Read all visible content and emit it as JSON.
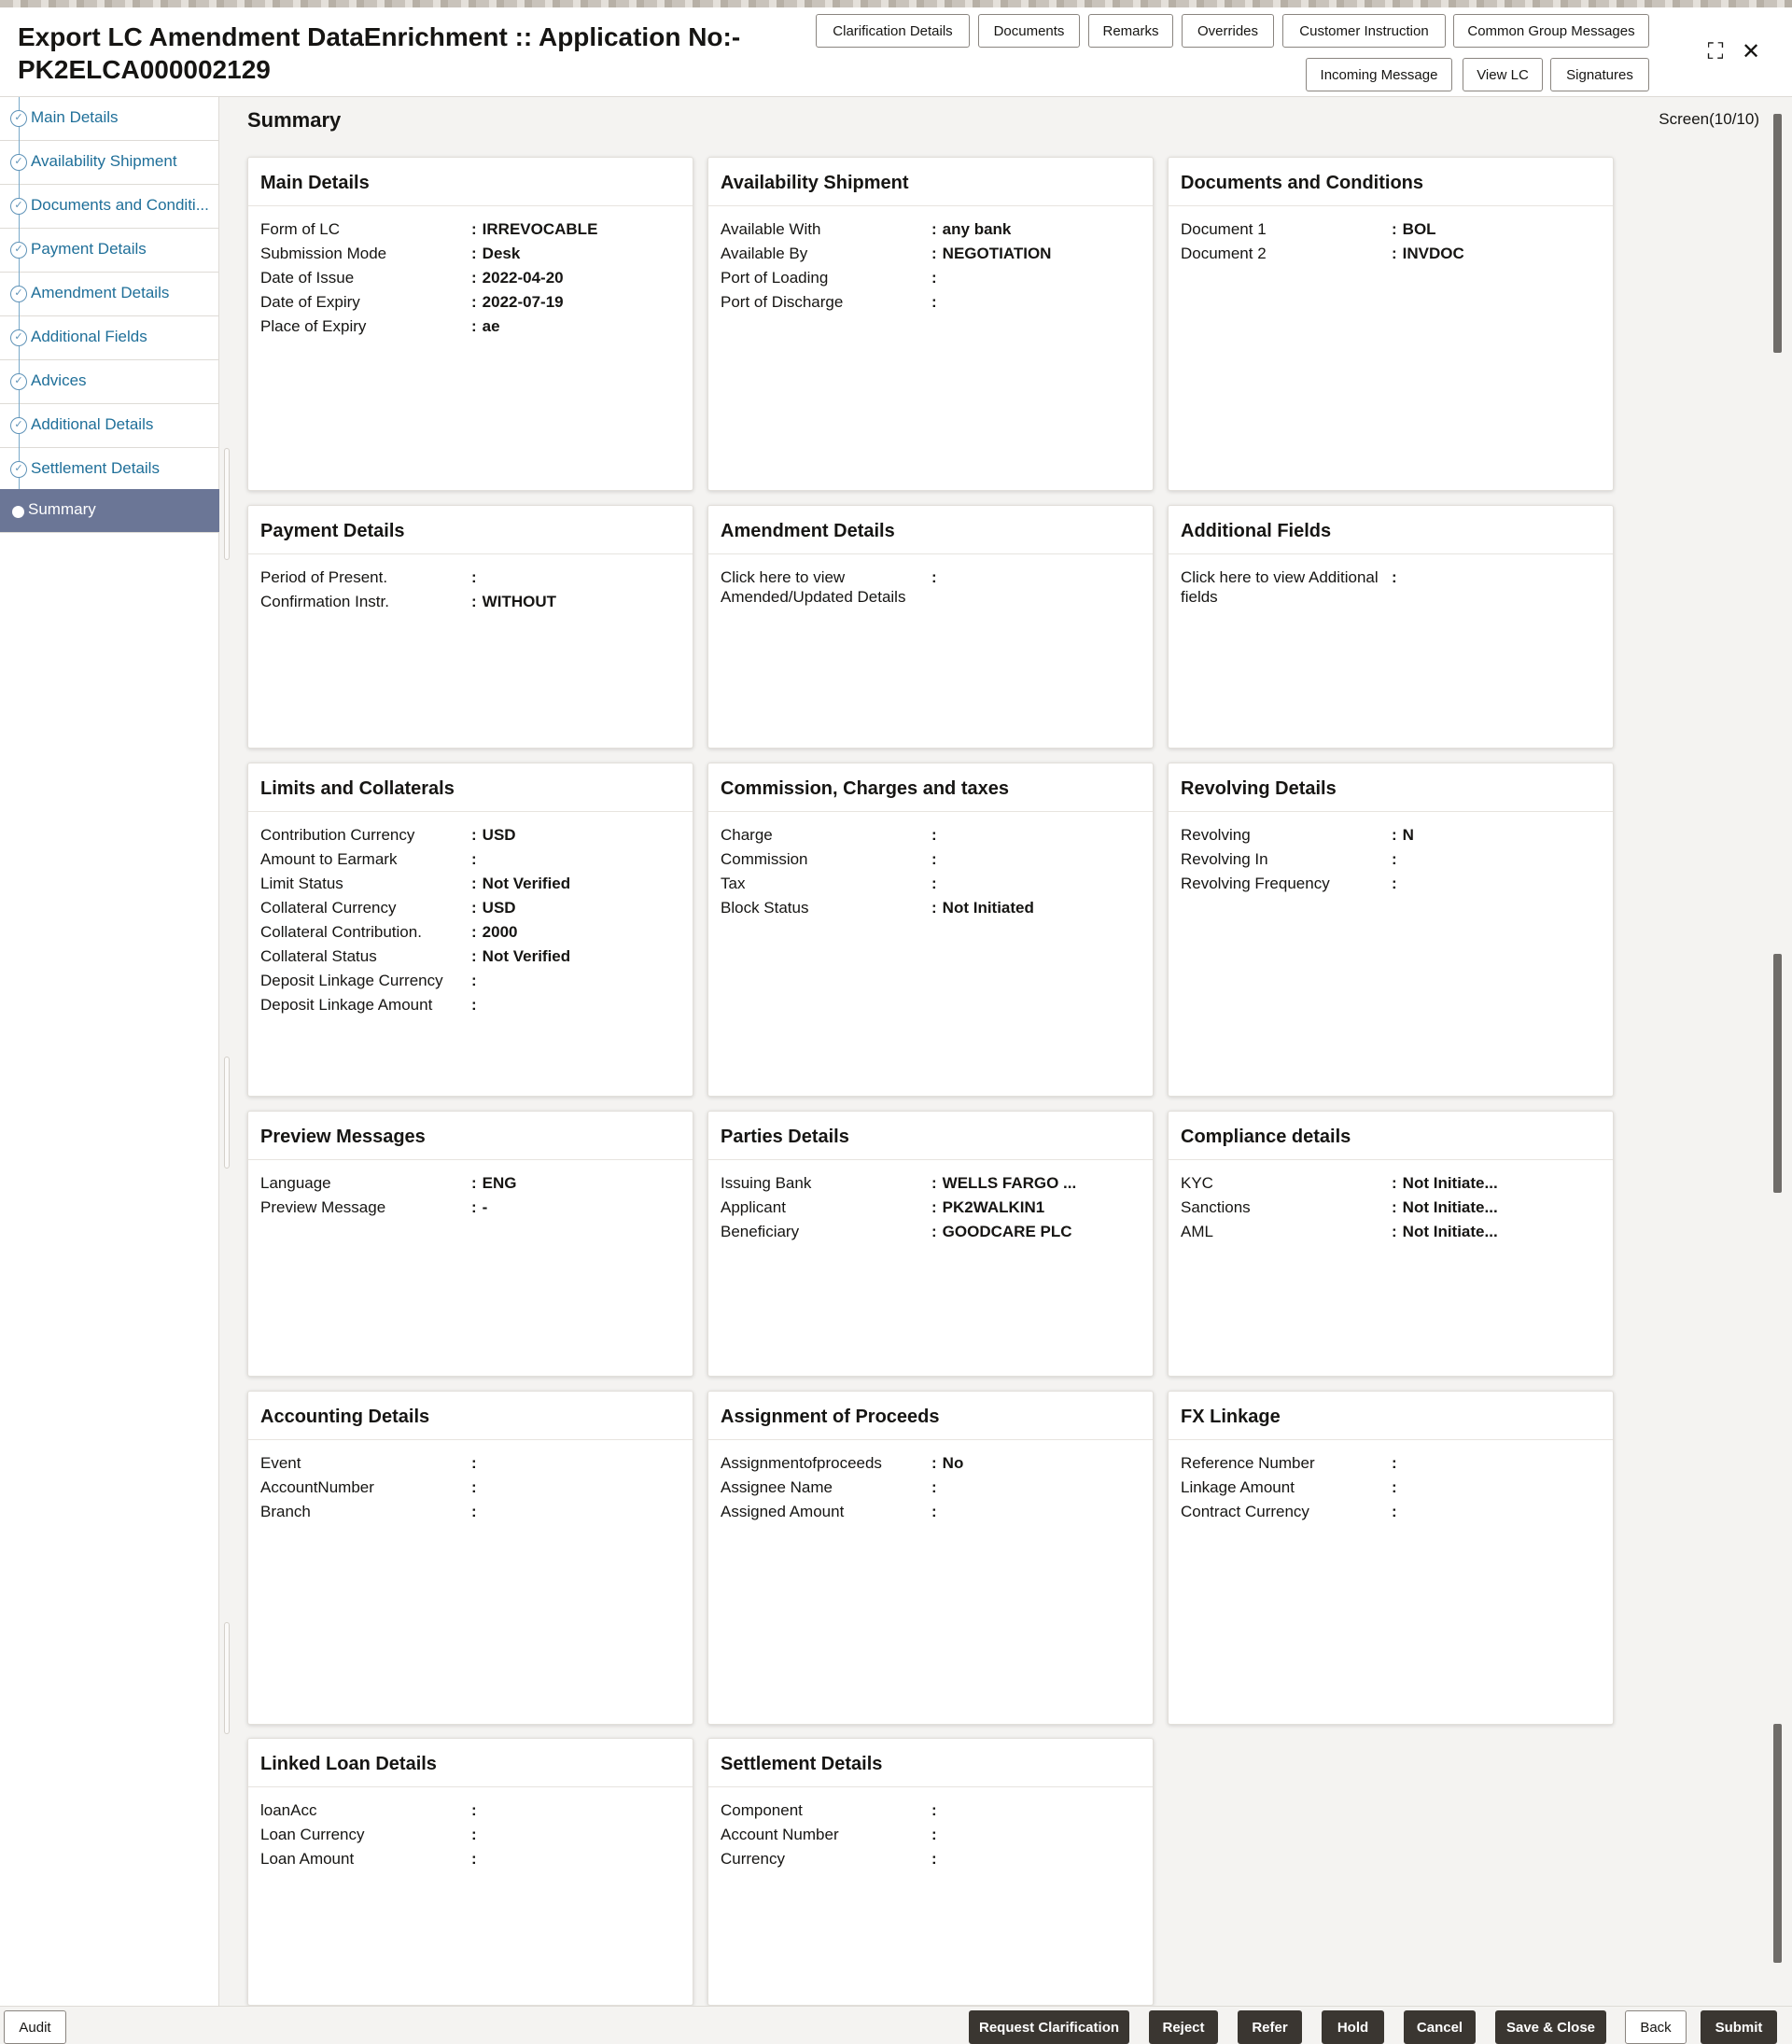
{
  "header": {
    "title": "Export LC Amendment DataEnrichment :: Application No:- PK2ELCA000002129",
    "buttons_row1": [
      "Clarification Details",
      "Documents",
      "Remarks",
      "Overrides",
      "Customer Instruction",
      "Common Group Messages"
    ],
    "buttons_row2": [
      "Incoming Message",
      "View LC",
      "Signatures"
    ],
    "minimize_glyph": "⛶",
    "close_glyph": "✕"
  },
  "sidebar": {
    "items": [
      {
        "label": "Main Details",
        "state": "done"
      },
      {
        "label": "Availability Shipment",
        "state": "done"
      },
      {
        "label": "Documents and Conditi...",
        "state": "done"
      },
      {
        "label": "Payment Details",
        "state": "done"
      },
      {
        "label": "Amendment Details",
        "state": "done"
      },
      {
        "label": "Additional Fields",
        "state": "done"
      },
      {
        "label": "Advices",
        "state": "done"
      },
      {
        "label": "Additional Details",
        "state": "done"
      },
      {
        "label": "Settlement Details",
        "state": "done"
      },
      {
        "label": "Summary",
        "state": "active"
      }
    ]
  },
  "main": {
    "title": "Summary",
    "screen_counter": "Screen(10/10)"
  },
  "cards": [
    {
      "title": "Main Details",
      "rows": [
        {
          "k": "Form of LC",
          "v": "IRREVOCABLE"
        },
        {
          "k": "Submission Mode",
          "v": "Desk"
        },
        {
          "k": "Date of Issue",
          "v": "2022-04-20"
        },
        {
          "k": "Date of Expiry",
          "v": "2022-07-19"
        },
        {
          "k": "Place of Expiry",
          "v": "ae"
        }
      ]
    },
    {
      "title": "Availability Shipment",
      "rows": [
        {
          "k": "Available With",
          "v": "any bank"
        },
        {
          "k": "Available By",
          "v": "NEGOTIATION"
        },
        {
          "k": "Port of Loading",
          "v": ""
        },
        {
          "k": "Port of Discharge",
          "v": ""
        }
      ]
    },
    {
      "title": "Documents and Conditions",
      "rows": [
        {
          "k": "Document 1",
          "v": "BOL"
        },
        {
          "k": "Document 2",
          "v": "INVDOC"
        }
      ]
    },
    {
      "title": "Payment Details",
      "rows": [
        {
          "k": "Period of Present.",
          "v": ""
        },
        {
          "k": "Confirmation Instr.",
          "v": "WITHOUT"
        }
      ]
    },
    {
      "title": "Amendment Details",
      "rows": [
        {
          "k": "Click here to view Amended/Updated Details",
          "v": ""
        }
      ]
    },
    {
      "title": "Additional Fields",
      "rows": [
        {
          "k": "Click here to view Additional fields",
          "v": ""
        }
      ]
    },
    {
      "title": "Limits and Collaterals",
      "rows": [
        {
          "k": "Contribution Currency",
          "v": "USD"
        },
        {
          "k": "Amount to Earmark",
          "v": ""
        },
        {
          "k": "Limit Status",
          "v": "Not Verified"
        },
        {
          "k": "Collateral Currency",
          "v": "USD"
        },
        {
          "k": "Collateral Contribution.",
          "v": "2000"
        },
        {
          "k": "Collateral Status",
          "v": "Not Verified"
        },
        {
          "k": "Deposit Linkage Currency",
          "v": ""
        },
        {
          "k": "Deposit Linkage Amount",
          "v": ""
        }
      ]
    },
    {
      "title": "Commission, Charges and taxes",
      "rows": [
        {
          "k": "Charge",
          "v": ""
        },
        {
          "k": "Commission",
          "v": ""
        },
        {
          "k": "Tax",
          "v": ""
        },
        {
          "k": "Block Status",
          "v": "Not Initiated"
        }
      ]
    },
    {
      "title": "Revolving Details",
      "rows": [
        {
          "k": "Revolving",
          "v": "N"
        },
        {
          "k": "Revolving In",
          "v": ""
        },
        {
          "k": "Revolving Frequency",
          "v": ""
        }
      ]
    },
    {
      "title": "Preview Messages",
      "rows": [
        {
          "k": "Language",
          "v": "ENG"
        },
        {
          "k": "Preview Message",
          "v": "-"
        }
      ]
    },
    {
      "title": "Parties Details",
      "rows": [
        {
          "k": "Issuing Bank",
          "v": "WELLS FARGO ..."
        },
        {
          "k": "Applicant",
          "v": "PK2WALKIN1"
        },
        {
          "k": "Beneficiary",
          "v": "GOODCARE PLC"
        }
      ]
    },
    {
      "title": "Compliance details",
      "rows": [
        {
          "k": "KYC",
          "v": "Not Initiate..."
        },
        {
          "k": "Sanctions",
          "v": "Not Initiate..."
        },
        {
          "k": "AML",
          "v": "Not Initiate..."
        }
      ]
    },
    {
      "title": "Accounting Details",
      "rows": [
        {
          "k": "Event",
          "v": ""
        },
        {
          "k": "AccountNumber",
          "v": ""
        },
        {
          "k": "Branch",
          "v": ""
        }
      ]
    },
    {
      "title": "Assignment of Proceeds",
      "rows": [
        {
          "k": "Assignmentofproceeds",
          "v": "No"
        },
        {
          "k": "Assignee Name",
          "v": ""
        },
        {
          "k": "Assigned Amount",
          "v": ""
        }
      ]
    },
    {
      "title": "FX Linkage",
      "rows": [
        {
          "k": "Reference Number",
          "v": ""
        },
        {
          "k": "Linkage Amount",
          "v": ""
        },
        {
          "k": "Contract Currency",
          "v": ""
        }
      ]
    },
    {
      "title": "Linked Loan Details",
      "rows": [
        {
          "k": "loanAcc",
          "v": ""
        },
        {
          "k": "Loan Currency",
          "v": ""
        },
        {
          "k": "Loan Amount",
          "v": ""
        }
      ]
    },
    {
      "title": "Settlement Details",
      "rows": [
        {
          "k": "Component",
          "v": ""
        },
        {
          "k": "Account Number",
          "v": ""
        },
        {
          "k": "Currency",
          "v": ""
        }
      ]
    }
  ],
  "footer": {
    "audit": "Audit",
    "actions": [
      "Request Clarification",
      "Reject",
      "Refer",
      "Hold",
      "Cancel",
      "Save & Close",
      "Back",
      "Submit"
    ]
  }
}
